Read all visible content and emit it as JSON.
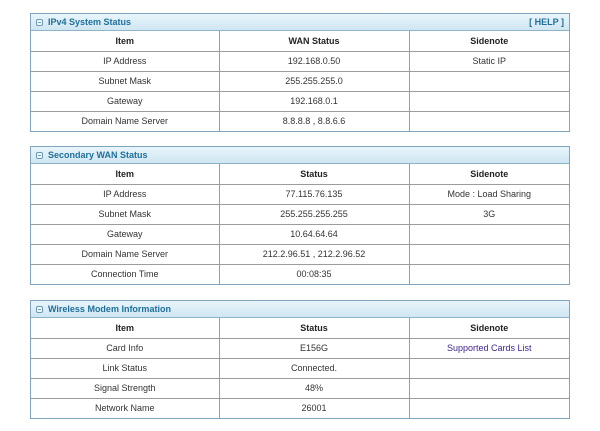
{
  "ipv4": {
    "title": "IPv4 System Status",
    "help": "[ HELP ]",
    "columns": [
      "Item",
      "WAN Status",
      "Sidenote"
    ],
    "rows": [
      {
        "item": "IP Address",
        "status": "192.168.0.50",
        "note": "Static IP"
      },
      {
        "item": "Subnet Mask",
        "status": "255.255.255.0",
        "note": ""
      },
      {
        "item": "Gateway",
        "status": "192.168.0.1",
        "note": ""
      },
      {
        "item": "Domain Name Server",
        "status": "8.8.8.8 , 8.8.6.6",
        "note": ""
      }
    ]
  },
  "secondary": {
    "title": "Secondary WAN Status",
    "columns": [
      "Item",
      "Status",
      "Sidenote"
    ],
    "rows": [
      {
        "item": "IP Address",
        "status": "77.115.76.135",
        "note": "Mode : Load Sharing"
      },
      {
        "item": "Subnet Mask",
        "status": "255.255.255.255",
        "note": "3G"
      },
      {
        "item": "Gateway",
        "status": "10.64.64.64",
        "note": ""
      },
      {
        "item": "Domain Name Server",
        "status": "212.2.96.51 , 212.2.96.52",
        "note": ""
      },
      {
        "item": "Connection Time",
        "status": "00:08:35",
        "note": ""
      }
    ]
  },
  "modem": {
    "title": "Wireless Modem Information",
    "columns": [
      "Item",
      "Status",
      "Sidenote"
    ],
    "rows": [
      {
        "item": "Card Info",
        "status": "E156G",
        "note": "Supported Cards List"
      },
      {
        "item": "Link Status",
        "status": "Connected.",
        "note": ""
      },
      {
        "item": "Signal Strength",
        "status": "48%",
        "note": ""
      },
      {
        "item": "Network Name",
        "status": "26001",
        "note": ""
      }
    ]
  },
  "colors": {
    "header_text": "#1f6f9a",
    "border": "#7fa6bd",
    "link": "#3d1f8e"
  }
}
